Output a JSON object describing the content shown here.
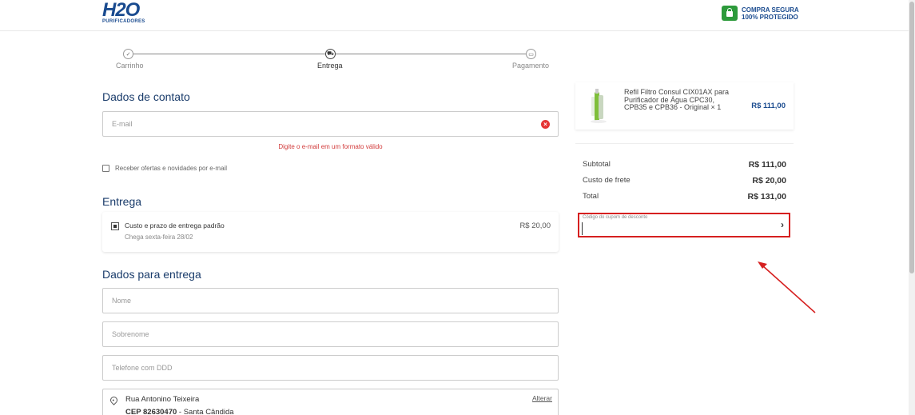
{
  "header": {
    "logo_main": "H2O",
    "logo_sub": "PURIFICADORES",
    "secure_line1": "COMPRA SEGURA",
    "secure_line2": "100% PROTEGIDO",
    "secure_icon": "lock-icon"
  },
  "stepper": {
    "steps": [
      {
        "label": "Carrinho",
        "icon": "check-icon",
        "glyph": "✓"
      },
      {
        "label": "Entrega",
        "icon": "truck-icon",
        "glyph": "⛟"
      },
      {
        "label": "Pagamento",
        "icon": "card-icon",
        "glyph": "▭"
      }
    ],
    "active_step": 1
  },
  "contact": {
    "title": "Dados de contato",
    "email_placeholder": "E-mail",
    "email_value": "",
    "error": "Digite o e-mail em um formato válido",
    "newsletter_label": "Receber ofertas e novidades por e-mail"
  },
  "shipping": {
    "title": "Entrega",
    "option_title": "Custo e prazo de entrega padrão",
    "option_sub": "Chega sexta-feira 28/02",
    "option_price": "R$ 20,00"
  },
  "delivery": {
    "title": "Dados para entrega",
    "name_placeholder": "Nome",
    "surname_placeholder": "Sobrenome",
    "phone_placeholder": "Telefone com DDD",
    "address_line1": "Rua Antonino Teixeira",
    "cep_label": "CEP 82630470",
    "cep_rest": " - Santa Cândida",
    "change_link": "Alterar"
  },
  "cart": {
    "product_name": "Refil Filtro Consul CIX01AX para Purificador de Água CPC30, CPB35 e CPB36 - Original × 1",
    "product_price": "R$ 111,00",
    "subtotal_label": "Subtotal",
    "subtotal_value": "R$ 111,00",
    "freight_label": "Custo de frete",
    "freight_value": "R$ 20,00",
    "total_label": "Total",
    "total_value": "R$ 131,00",
    "coupon_label": "Código do cupom de desconto",
    "coupon_value": ""
  },
  "colors": {
    "brand": "#1a4b8f",
    "error": "#d23b3b",
    "secure": "#2d9a3b",
    "highlight": "#d62020"
  }
}
